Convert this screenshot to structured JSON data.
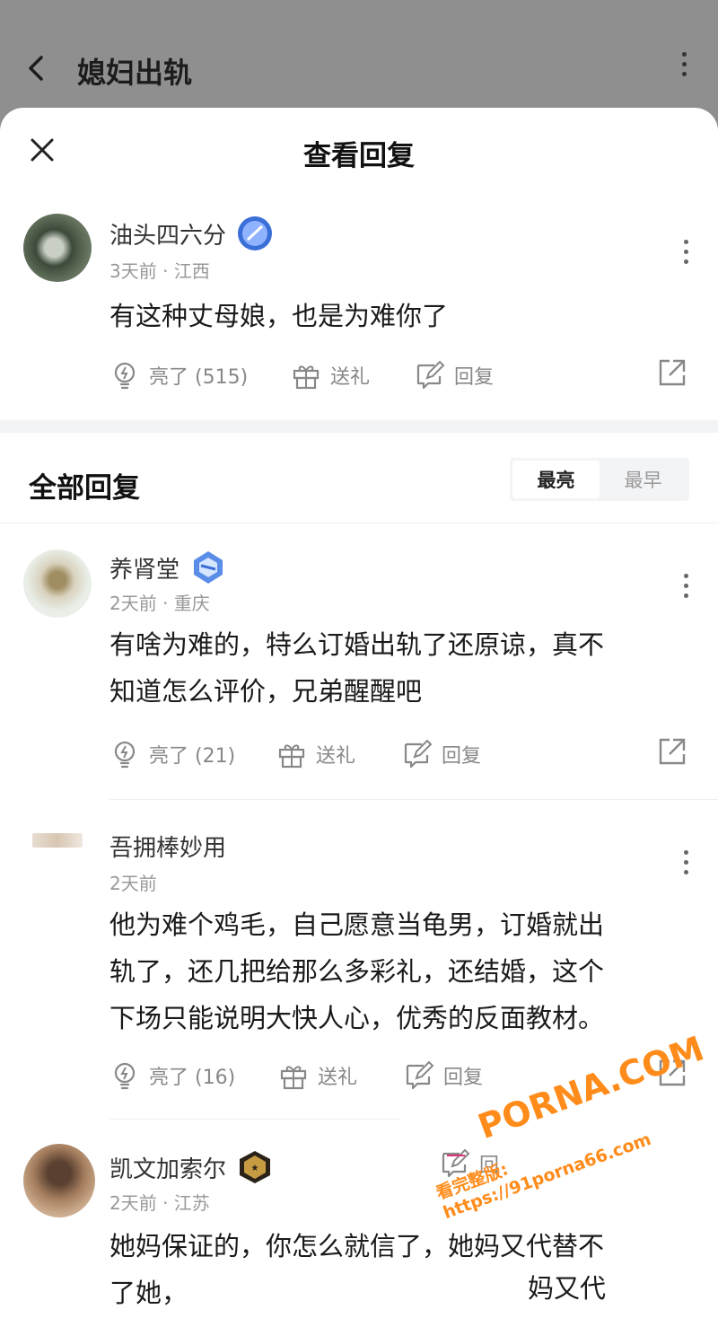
{
  "bg_header": {
    "title": "媳妇出轨"
  },
  "sheet": {
    "title": "查看回复",
    "section_title": "全部回复",
    "sort": [
      "最亮",
      "最早"
    ]
  },
  "main_comment": {
    "username": "油头四六分",
    "meta": "3天前 · 江西",
    "text": "有这种丈母娘，也是为难你了",
    "likes": "亮了 (515)",
    "gift": "送礼",
    "reply": "回复"
  },
  "replies": [
    {
      "username": "养肾堂",
      "meta": "2天前 · 重庆",
      "lines": [
        "有啥为难的，特么订婚出轨了还原谅，真不",
        "知道怎么评价，兄弟醒醒吧"
      ],
      "likes": "亮了 (21)",
      "gift": "送礼",
      "reply": "回复"
    },
    {
      "username": "吾拥棒妙用",
      "meta": "2天前",
      "lines": [
        "他为难个鸡毛，自己愿意当龟男，订婚就出",
        "轨了，还几把给那么多彩礼，还结婚，这个",
        "下场只能说明大快人心，优秀的反面教材。"
      ],
      "likes": "亮了 (16)",
      "gift": "送礼",
      "reply": "回复"
    },
    {
      "username": "凯文加索尔",
      "meta": "2天前 · 江苏",
      "lines": [
        "她妈保证的，你怎么就信了，她妈又代替不",
        "了她，"
      ],
      "reply_partial": "回"
    }
  ],
  "overlay_text": "妈又代",
  "watermark": {
    "brand": "PORNA.COM",
    "url": "看完整版: https://91porna66.com"
  },
  "colors": {
    "accent_badge": "#3a6fd8",
    "muted": "#999999",
    "watermark": "#ff8c1a"
  }
}
